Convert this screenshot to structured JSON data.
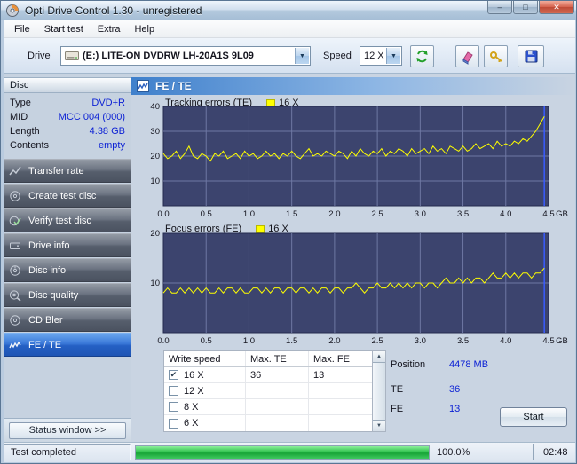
{
  "window": {
    "title": "Opti Drive Control 1.30 - unregistered"
  },
  "menu": {
    "items": [
      "File",
      "Start test",
      "Extra",
      "Help"
    ]
  },
  "toolbar": {
    "drive_label": "Drive",
    "drive_value": "(E:)   LITE-ON DVDRW LH-20A1S 9L09",
    "speed_label": "Speed",
    "speed_value": "12 X"
  },
  "sidebar": {
    "disc_header": "Disc",
    "fields": [
      {
        "label": "Type",
        "value": "DVD+R"
      },
      {
        "label": "MID",
        "value": "MCC 004 (000)"
      },
      {
        "label": "Length",
        "value": "4.38 GB"
      },
      {
        "label": "Contents",
        "value": "empty"
      }
    ],
    "buttons": [
      {
        "label": "Transfer rate",
        "selected": false
      },
      {
        "label": "Create test disc",
        "selected": false
      },
      {
        "label": "Verify test disc",
        "selected": false
      },
      {
        "label": "Drive info",
        "selected": false
      },
      {
        "label": "Disc info",
        "selected": false
      },
      {
        "label": "Disc quality",
        "selected": false
      },
      {
        "label": "CD Bler",
        "selected": false
      },
      {
        "label": "FE / TE",
        "selected": true
      }
    ],
    "status_window_button": "Status window >>"
  },
  "main": {
    "header": "FE / TE",
    "table": {
      "headers": [
        "Write speed",
        "Max. TE",
        "Max. FE"
      ],
      "rows": [
        {
          "checked": true,
          "speed": "16 X",
          "max_te": "36",
          "max_fe": "13"
        },
        {
          "checked": false,
          "speed": "12 X",
          "max_te": "",
          "max_fe": ""
        },
        {
          "checked": false,
          "speed": "8 X",
          "max_te": "",
          "max_fe": ""
        },
        {
          "checked": false,
          "speed": "6 X",
          "max_te": "",
          "max_fe": ""
        }
      ]
    },
    "info": {
      "position_label": "Position",
      "position_value": "4478 MB",
      "te_label": "TE",
      "te_value": "36",
      "fe_label": "FE",
      "fe_value": "13"
    },
    "start_button": "Start"
  },
  "statusbar": {
    "status": "Test completed",
    "progress_percent": "100.0%",
    "progress_value": 100,
    "time": "02:48"
  },
  "chart_data": [
    {
      "type": "line",
      "title": "Tracking errors (TE)",
      "legend": "16 X",
      "ylim": [
        0,
        40
      ],
      "yticks": [
        10,
        20,
        30,
        40
      ],
      "xlim": [
        0,
        4.5
      ],
      "xticks": [
        0,
        0.5,
        1,
        1.5,
        2,
        2.5,
        3,
        3.5,
        4,
        4.5
      ],
      "x_unit": "GB",
      "x_start": 0,
      "x_step": 0.05,
      "bg": "#3c446e",
      "grid_color": "#6e78a4",
      "line_color": "#ffff00",
      "cursor_color": "#3a5cff",
      "cursor_x": 4.45,
      "values": [
        21,
        19,
        20,
        22,
        19,
        21,
        24,
        20,
        19,
        21,
        20,
        18,
        21,
        20,
        22,
        19,
        20,
        21,
        19,
        22,
        20,
        21,
        19,
        20,
        22,
        20,
        21,
        19,
        21,
        20,
        22,
        20,
        19,
        21,
        23,
        20,
        21,
        20,
        22,
        21,
        20,
        22,
        21,
        19,
        22,
        20,
        23,
        21,
        20,
        22,
        21,
        23,
        20,
        22,
        21,
        23,
        22,
        20,
        23,
        21,
        22,
        23,
        21,
        24,
        22,
        23,
        21,
        24,
        23,
        22,
        24,
        22,
        23,
        25,
        23,
        24,
        25,
        23,
        26,
        24,
        25,
        24,
        26,
        25,
        27,
        26,
        28,
        30,
        33,
        36
      ]
    },
    {
      "type": "line",
      "title": "Focus errors (FE)",
      "legend": "16 X",
      "ylim": [
        0,
        20
      ],
      "yticks": [
        10,
        20
      ],
      "xlim": [
        0,
        4.5
      ],
      "xticks": [
        0,
        0.5,
        1,
        1.5,
        2,
        2.5,
        3,
        3.5,
        4,
        4.5
      ],
      "x_unit": "GB",
      "x_start": 0,
      "x_step": 0.05,
      "bg": "#3c446e",
      "grid_color": "#6e78a4",
      "line_color": "#ffff00",
      "cursor_color": "#3a5cff",
      "cursor_x": 4.45,
      "values": [
        8,
        9,
        8,
        8,
        9,
        8,
        9,
        8,
        9,
        8,
        9,
        8,
        8,
        9,
        8,
        9,
        9,
        8,
        9,
        8,
        8,
        9,
        9,
        8,
        9,
        8,
        9,
        9,
        8,
        9,
        9,
        8,
        9,
        9,
        8,
        9,
        8,
        9,
        9,
        8,
        9,
        9,
        8,
        9,
        9,
        10,
        9,
        8,
        9,
        9,
        10,
        9,
        9,
        10,
        9,
        10,
        9,
        10,
        9,
        10,
        10,
        9,
        10,
        10,
        9,
        10,
        11,
        10,
        10,
        11,
        10,
        11,
        10,
        11,
        11,
        10,
        11,
        12,
        11,
        11,
        12,
        11,
        12,
        11,
        12,
        12,
        11,
        12,
        12,
        13
      ]
    }
  ]
}
